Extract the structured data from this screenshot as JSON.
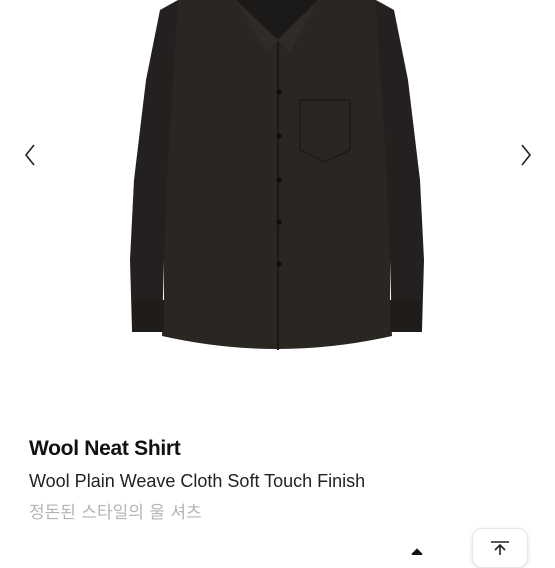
{
  "gallery": {
    "image_alt_icon": "shirt-image",
    "prev_icon": "chevron-left-icon",
    "next_icon": "chevron-right-icon"
  },
  "product": {
    "name": "Wool Neat Shirt",
    "description": "Wool Plain Weave Cloth Soft Touch Finish",
    "description_ko": "정돈된 스타일의 울 셔츠"
  },
  "scroll_top": {
    "icon": "arrow-up-icon"
  },
  "colors": {
    "shirt": "#2a2622",
    "secondary_text": "#b4b4b4",
    "primary_text": "#111111"
  }
}
